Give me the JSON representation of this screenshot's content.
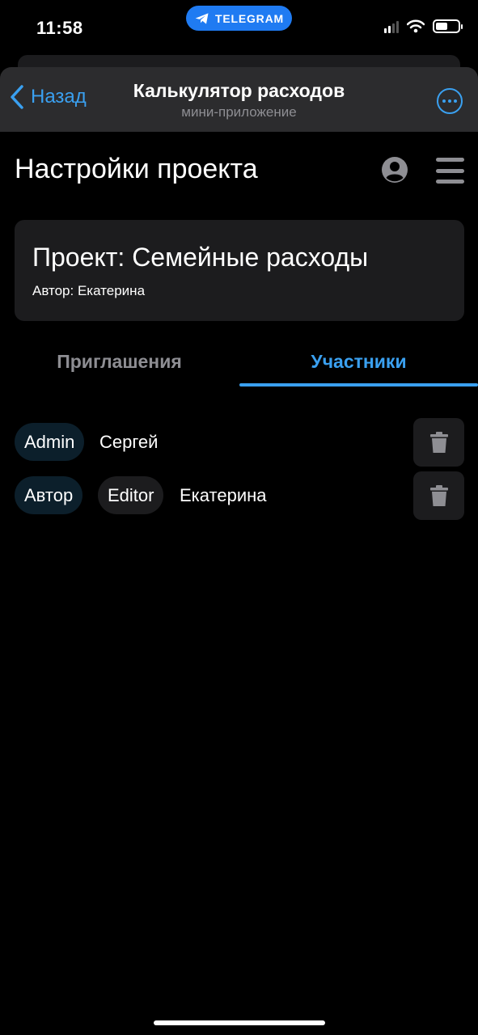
{
  "status_bar": {
    "time": "11:58",
    "telegram_pill": "TELEGRAM"
  },
  "header": {
    "back_label": "Назад",
    "title": "Калькулятор расходов",
    "subtitle": "мини-приложение",
    "accent_color": "#3aa0f0"
  },
  "page": {
    "title": "Настройки проекта",
    "icons": [
      "profile-icon",
      "menu-icon"
    ]
  },
  "project": {
    "name": "Проект: Семейные расходы",
    "author": "Автор: Екатерина"
  },
  "tabs": [
    {
      "label": "Приглашения",
      "active": false
    },
    {
      "label": "Участники",
      "active": true
    }
  ],
  "members": [
    {
      "roles": [
        "Admin"
      ],
      "name": "Сергей"
    },
    {
      "roles": [
        "Автор",
        "Editor"
      ],
      "name": "Екатерина"
    }
  ]
}
